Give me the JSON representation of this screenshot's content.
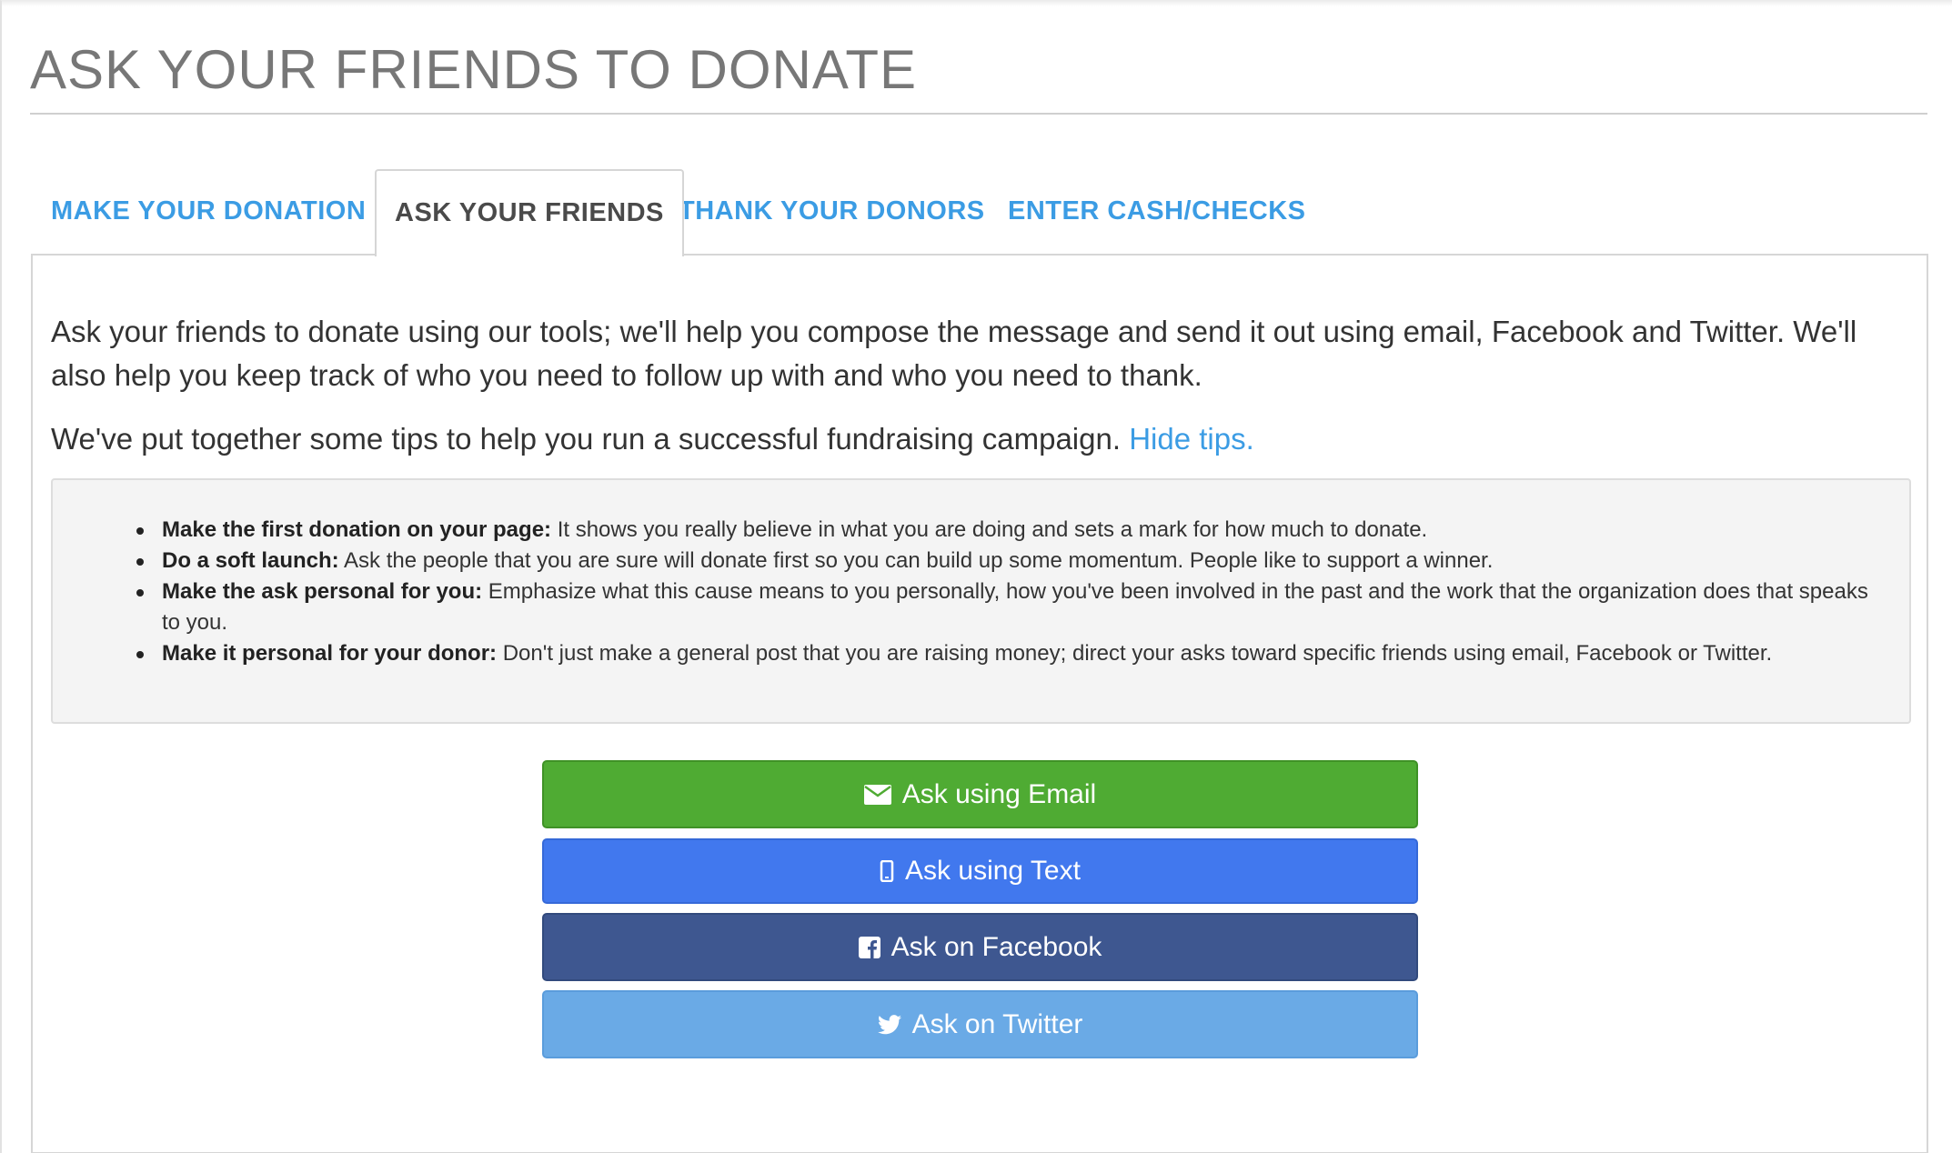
{
  "page": {
    "title": "ASK YOUR FRIENDS TO DONATE"
  },
  "tabs": [
    {
      "label": "MAKE YOUR DONATION",
      "active": false
    },
    {
      "label": "ASK YOUR FRIENDS",
      "active": true
    },
    {
      "label": "THANK YOUR DONORS",
      "active": false
    },
    {
      "label": "ENTER CASH/CHECKS",
      "active": false
    }
  ],
  "panel": {
    "intro": "Ask your friends to donate using our tools; we'll help you compose the message and send it out using email, Facebook and Twitter. We'll also help you keep track of who you need to follow up with and who you need to thank.",
    "tips_prompt": "We've put together some tips to help you run a successful fundraising campaign.",
    "hide_tips_link": "Hide tips.",
    "tips": [
      {
        "title": "Make the first donation on your page:",
        "text": " It shows you really believe in what you are doing and sets a mark for how much to donate."
      },
      {
        "title": "Do a soft launch:",
        "text": " Ask the people that you are sure will donate first so you can build up some momentum. People like to support a winner."
      },
      {
        "title": "Make the ask personal for you:",
        "text": " Emphasize what this cause means to you personally, how you've been involved in the past and the work that the organization does that speaks to you."
      },
      {
        "title": "Make it personal for your donor:",
        "text": " Don't just make a general post that you are raising money; direct your asks toward specific friends using email, Facebook or Twitter."
      }
    ]
  },
  "buttons": {
    "email": {
      "label": "Ask using Email",
      "icon": "envelope-icon",
      "color": "#4fab33"
    },
    "text": {
      "label": "Ask using Text",
      "icon": "mobile-phone-icon",
      "color": "#4178ee"
    },
    "facebook": {
      "label": "Ask on Facebook",
      "icon": "facebook-icon",
      "color": "#3e5790"
    },
    "twitter": {
      "label": "Ask on Twitter",
      "icon": "twitter-icon",
      "color": "#6aaae6"
    }
  },
  "colors": {
    "link": "#3b9ce4",
    "title": "#777777",
    "tips_background": "#f4f4f4"
  }
}
